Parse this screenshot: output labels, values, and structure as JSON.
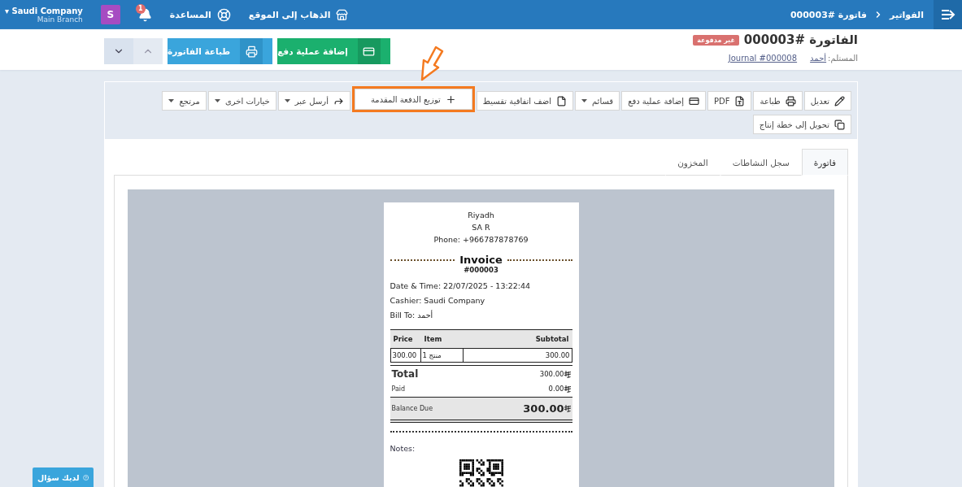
{
  "topbar": {
    "breadcrumbs": [
      {
        "label": "الفواتير"
      },
      {
        "label": "فاتورة #000003"
      }
    ],
    "links": [
      {
        "kind": "site",
        "label": "الذهاب إلى الموقع"
      },
      {
        "kind": "help",
        "label": "المساعدة"
      }
    ],
    "notifications": "1",
    "avatar": "S",
    "company_caret": "▾",
    "company": "Saudi Company",
    "branch": "Main Branch"
  },
  "header": {
    "title": "الفاتورة #000003",
    "status": "غير مدفوعة",
    "recipient_label": "المستلم:",
    "recipient": "أحمد",
    "journal": "Journal #000008",
    "actions": [
      {
        "kind": "payment",
        "label": "إضافة عملية دفع"
      },
      {
        "kind": "print",
        "label": "طباعة الفاتورة"
      }
    ]
  },
  "toolbar": {
    "rows": [
      [
        {
          "kind": "pencil",
          "label": "تعديل",
          "dropdown": false,
          "highlighted": false
        },
        {
          "kind": "printer",
          "label": "طباعة",
          "dropdown": false,
          "highlighted": false
        },
        {
          "kind": "pdf",
          "label": "PDF",
          "dropdown": false,
          "highlighted": false
        },
        {
          "kind": "card",
          "label": "إضافة عملية دفع",
          "dropdown": false,
          "highlighted": false
        },
        {
          "kind": "plain",
          "label": "قسائم",
          "dropdown": true,
          "highlighted": false
        },
        {
          "kind": "file",
          "label": "اضف اتفاقية تقسيط",
          "dropdown": false,
          "highlighted": false
        },
        {
          "kind": "plus",
          "label": "توزيع الدفعة المقدمة",
          "dropdown": false,
          "highlighted": true
        },
        {
          "kind": "share",
          "label": "أرسل عبر",
          "dropdown": true,
          "highlighted": false
        },
        {
          "kind": "plain",
          "label": "خيارات اخرى",
          "dropdown": true,
          "highlighted": false
        },
        {
          "kind": "plain",
          "label": "مرتجع",
          "dropdown": true,
          "highlighted": false
        }
      ],
      [
        {
          "kind": "copy",
          "label": "تحويل إلى خطة إنتاج",
          "dropdown": false,
          "highlighted": false
        }
      ]
    ]
  },
  "tabs": [
    {
      "label": "فاتورة",
      "selected": true
    },
    {
      "label": "سجل النشاطات",
      "selected": false
    },
    {
      "label": "المخزون",
      "selected": false
    }
  ],
  "receipt": {
    "address": [
      "Riyadh",
      "SA R",
      "Phone: +966787878769"
    ],
    "title": "Invoice",
    "number": "#000003",
    "info": [
      "Date & Time: 22/07/2025 - 13:22:44",
      "Cashier: Saudi Company",
      "Bill To: أحمد"
    ],
    "headers": {
      "price": "Price",
      "item": "Item",
      "subtotal": "Subtotal"
    },
    "lines": [
      {
        "price": "300.00",
        "item": "منتج 1",
        "subtotal": "300.00"
      }
    ],
    "totals": [
      {
        "kind": "total",
        "label": "Total",
        "value": "300.00"
      },
      {
        "kind": "paid",
        "label": "Paid",
        "value": "0.00"
      },
      {
        "kind": "balance",
        "label": "Balance Due",
        "value": "300.00"
      }
    ],
    "notes_label": "Notes:"
  },
  "help_button": "لديك سؤال"
}
